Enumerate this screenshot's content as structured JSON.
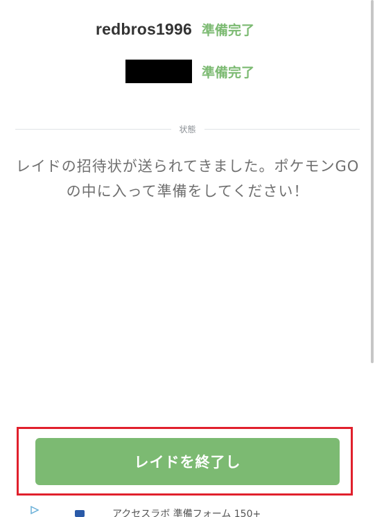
{
  "players": [
    {
      "name": "redbros1996",
      "status": "準備完了"
    },
    {
      "name": "",
      "status": "準備完了"
    }
  ],
  "divider": {
    "label": "状態"
  },
  "status_message": "レイドの招待状が送られてきました。ポケモンGOの中に入って準備をしてください！",
  "end_button_label": "レイドを終了し",
  "ad": {
    "text": "アクセスラボ 準備フォーム 150+"
  },
  "colors": {
    "accent_green": "#7cba72",
    "highlight_red": "#e0202c",
    "text_gray": "#6f6f6f"
  }
}
